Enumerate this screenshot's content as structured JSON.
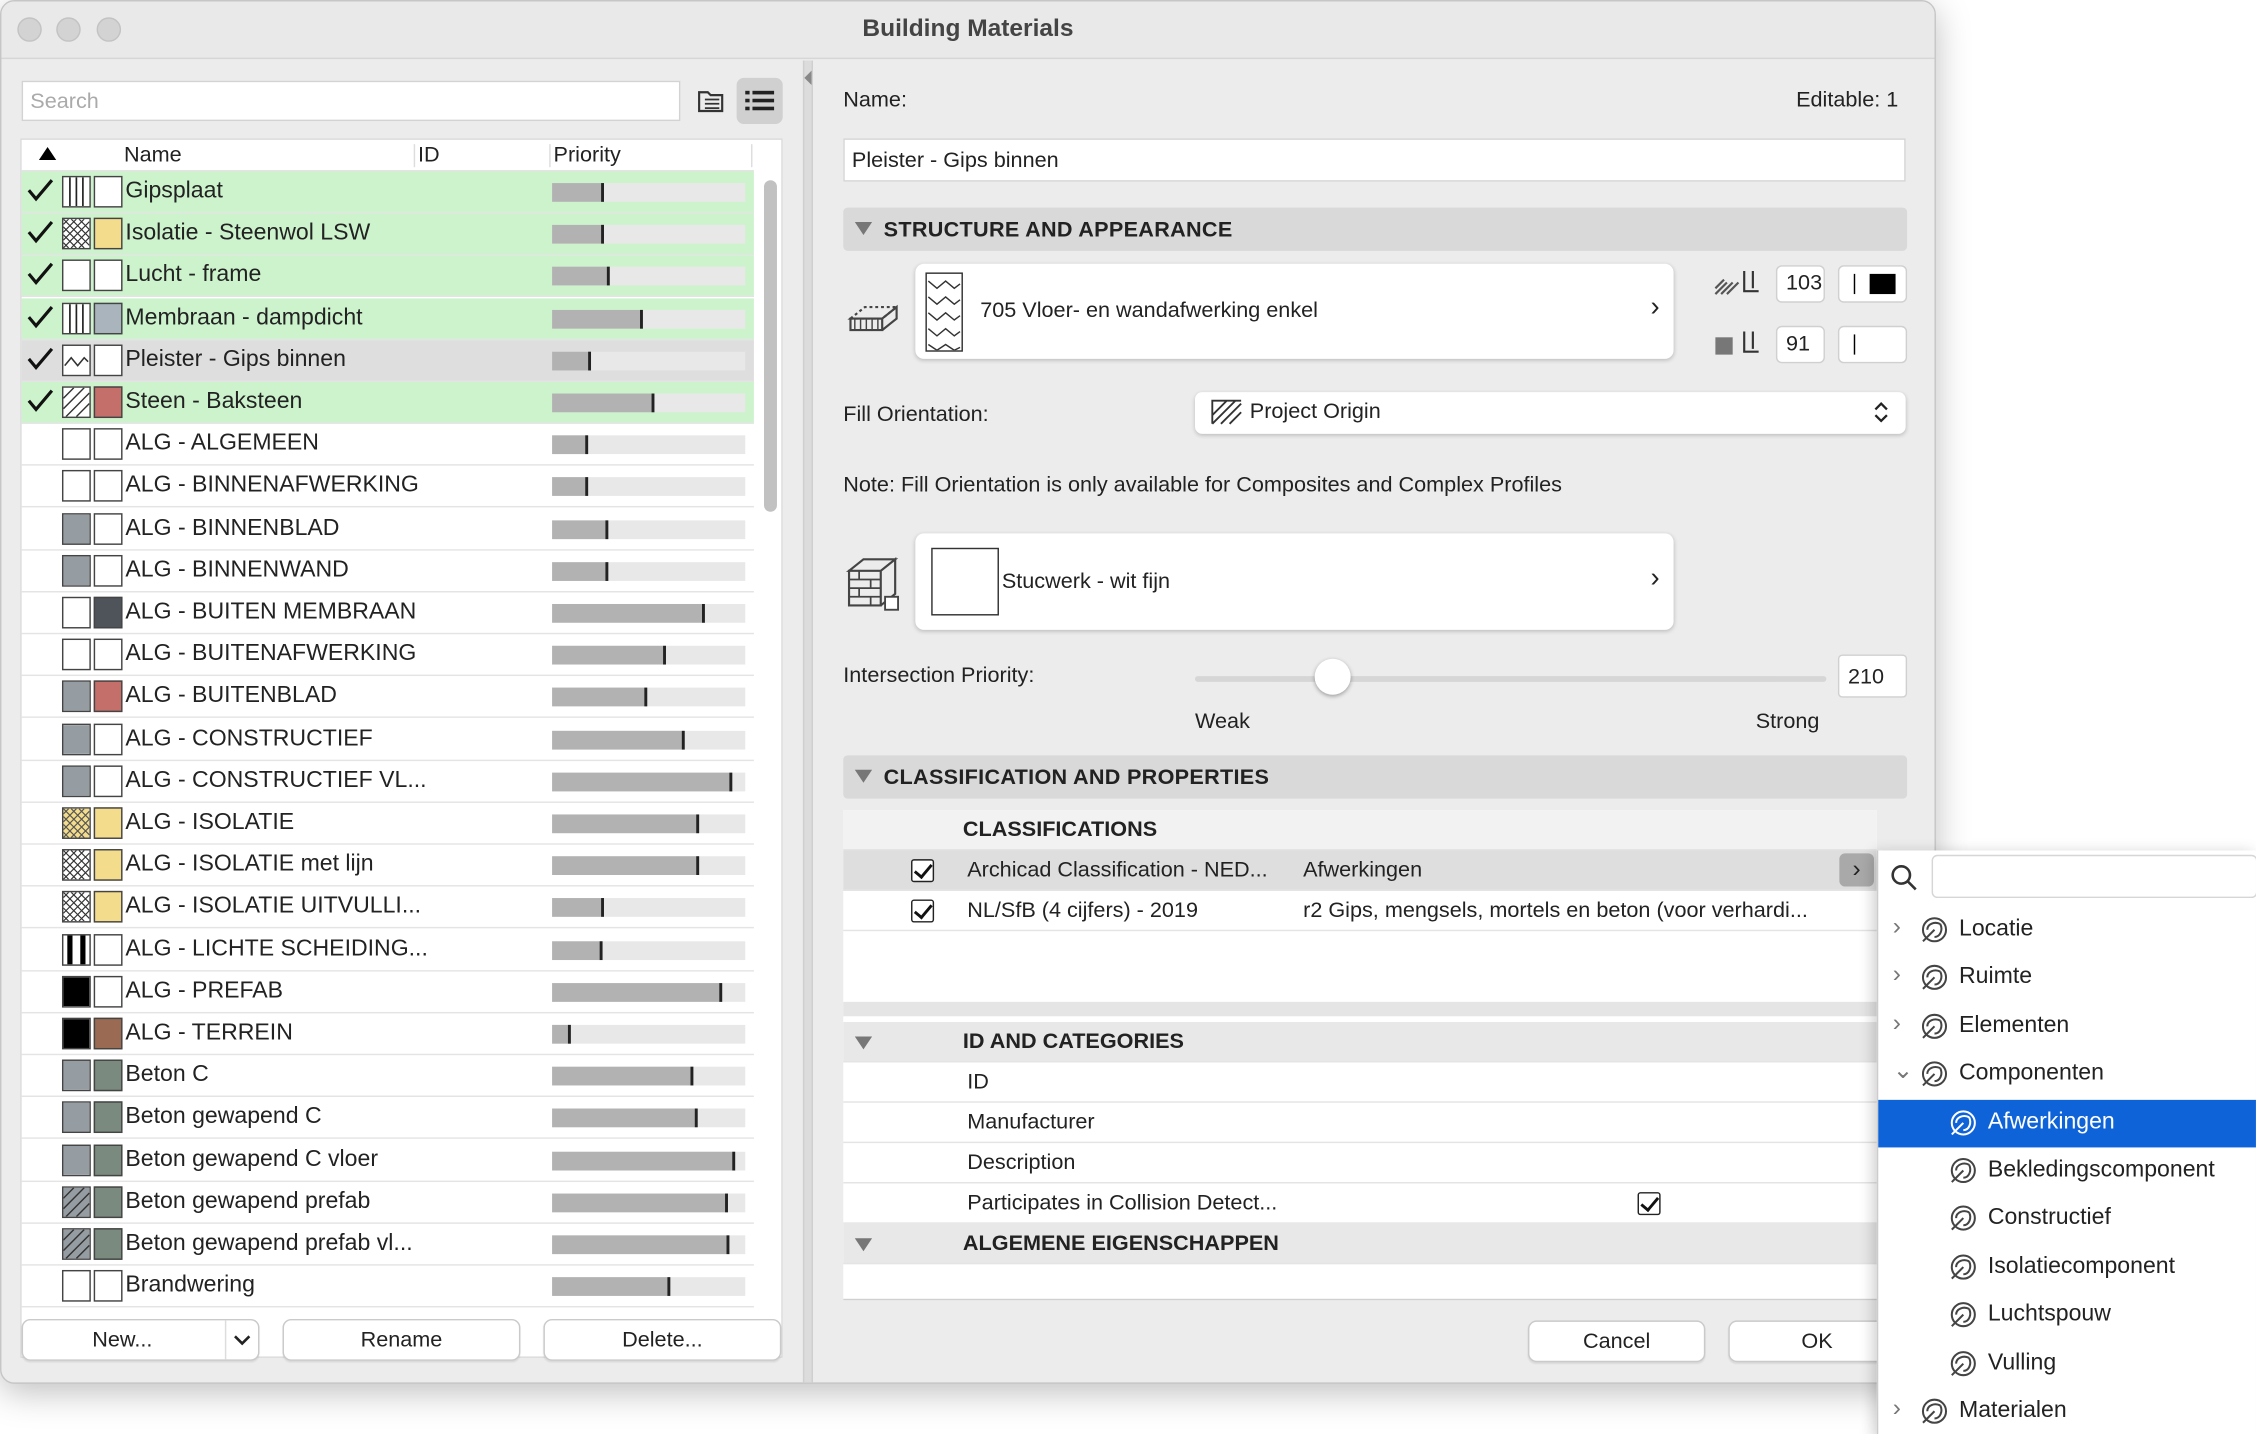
{
  "window": {
    "title": "Building Materials"
  },
  "search": {
    "placeholder": "Search"
  },
  "list": {
    "columns": {
      "name": "Name",
      "id": "ID",
      "priority": "Priority"
    },
    "rows": [
      {
        "name": "Gipsplaat",
        "checked": true,
        "state": "sel",
        "fill": "vlines",
        "color": "#ffffff",
        "priority": 0.27
      },
      {
        "name": "Isolatie - Steenwol LSW",
        "checked": true,
        "state": "sel",
        "fill": "cross",
        "color": "#f3dc8c",
        "priority": 0.27
      },
      {
        "name": "Lucht - frame",
        "checked": true,
        "state": "sel",
        "fill": "empty",
        "color": "#ffffff",
        "priority": 0.3
      },
      {
        "name": "Membraan - dampdicht",
        "checked": true,
        "state": "sel",
        "fill": "vlines",
        "color": "#aab4bc",
        "priority": 0.47
      },
      {
        "name": "Pleister - Gips binnen",
        "checked": true,
        "state": "cur",
        "fill": "zigzag",
        "color": "#ffffff",
        "priority": 0.2
      },
      {
        "name": "Steen - Baksteen",
        "checked": true,
        "state": "sel",
        "fill": "diag",
        "color": "#c46f6a",
        "priority": 0.53
      },
      {
        "name": "ALG - ALGEMEEN",
        "checked": false,
        "state": "",
        "fill": "empty",
        "color": "#ffffff",
        "priority": 0.19
      },
      {
        "name": "ALG - BINNENAFWERKING",
        "checked": false,
        "state": "",
        "fill": "empty",
        "color": "#ffffff",
        "priority": 0.19
      },
      {
        "name": "ALG - BINNENBLAD",
        "checked": false,
        "state": "",
        "fill": "gray",
        "color": "#ffffff",
        "priority": 0.29
      },
      {
        "name": "ALG - BINNENWAND",
        "checked": false,
        "state": "",
        "fill": "gray",
        "color": "#ffffff",
        "priority": 0.29
      },
      {
        "name": "ALG - BUITEN MEMBRAAN",
        "checked": false,
        "state": "",
        "fill": "empty",
        "color": "#4e5459",
        "priority": 0.79
      },
      {
        "name": "ALG - BUITENAFWERKING",
        "checked": false,
        "state": "",
        "fill": "empty",
        "color": "#ffffff",
        "priority": 0.59
      },
      {
        "name": "ALG - BUITENBLAD",
        "checked": false,
        "state": "",
        "fill": "gray",
        "color": "#c46f6a",
        "priority": 0.49
      },
      {
        "name": "ALG - CONSTRUCTIEF",
        "checked": false,
        "state": "",
        "fill": "gray",
        "color": "#ffffff",
        "priority": 0.69
      },
      {
        "name": "ALG - CONSTRUCTIEF VL...",
        "checked": false,
        "state": "",
        "fill": "gray",
        "color": "#ffffff",
        "priority": 0.93
      },
      {
        "name": "ALG - ISOLATIE",
        "checked": false,
        "state": "",
        "fill": "crossy",
        "color": "#f3dc8c",
        "priority": 0.76
      },
      {
        "name": "ALG - ISOLATIE met lijn",
        "checked": false,
        "state": "",
        "fill": "cross",
        "color": "#f3dc8c",
        "priority": 0.76
      },
      {
        "name": "ALG - ISOLATIE UITVULLI...",
        "checked": false,
        "state": "",
        "fill": "cross",
        "color": "#f3dc8c",
        "priority": 0.27
      },
      {
        "name": "ALG - LICHTE SCHEIDING...",
        "checked": false,
        "state": "",
        "fill": "bars",
        "color": "#ffffff",
        "priority": 0.26
      },
      {
        "name": "ALG - PREFAB",
        "checked": false,
        "state": "",
        "fill": "black",
        "color": "#ffffff",
        "priority": 0.88
      },
      {
        "name": "ALG - TERREIN",
        "checked": false,
        "state": "",
        "fill": "black",
        "color": "#9a6b52",
        "priority": 0.1
      },
      {
        "name": "Beton C",
        "checked": false,
        "state": "",
        "fill": "gray",
        "color": "#7a8a7e",
        "priority": 0.73
      },
      {
        "name": "Beton gewapend C",
        "checked": false,
        "state": "",
        "fill": "gray",
        "color": "#7a8a7e",
        "priority": 0.75
      },
      {
        "name": "Beton gewapend C vloer",
        "checked": false,
        "state": "",
        "fill": "gray",
        "color": "#7a8a7e",
        "priority": 0.95
      },
      {
        "name": "Beton gewapend prefab",
        "checked": false,
        "state": "",
        "fill": "graydiag",
        "color": "#7a8a7e",
        "priority": 0.91
      },
      {
        "name": "Beton gewapend prefab vl...",
        "checked": false,
        "state": "",
        "fill": "graydiag",
        "color": "#7a8a7e",
        "priority": 0.92
      },
      {
        "name": "Brandwering",
        "checked": false,
        "state": "",
        "fill": "empty",
        "color": "#ffffff",
        "priority": 0.61
      }
    ]
  },
  "buttons": {
    "new": "New...",
    "rename": "Rename",
    "delete": "Delete...",
    "cancel": "Cancel",
    "ok": "OK"
  },
  "detail": {
    "name_label": "Name:",
    "editable": "Editable: 1",
    "name_value": "Pleister - Gips binnen",
    "structure": {
      "header": "STRUCTURE AND APPEARANCE",
      "fill_name": "705 Vloer- en wandafwerking enkel",
      "pen1": "103",
      "pen2": "91",
      "orientation_label": "Fill Orientation:",
      "orientation_value": "Project Origin",
      "note": "Note: Fill Orientation is only available for Composites and Complex Profiles",
      "surface_name": "Stucwerk - wit fijn",
      "priority_label": "Intersection Priority:",
      "priority_value": "210",
      "weak": "Weak",
      "strong": "Strong"
    },
    "classification": {
      "header": "CLASSIFICATION AND PROPERTIES",
      "sub_header": "CLASSIFICATIONS",
      "rows": [
        {
          "system": "Archicad Classification - NED...",
          "value": "Afwerkingen"
        },
        {
          "system": "NL/SfB (4 cijfers) - 2019",
          "value": "r2 Gips, mengsels, mortels en beton (voor verhardi..."
        }
      ],
      "id_header": "ID AND CATEGORIES",
      "props": [
        "ID",
        "Manufacturer",
        "Description",
        "Participates in Collision Detect..."
      ],
      "general_header": "ALGEMENE EIGENSCHAPPEN"
    }
  },
  "popup": {
    "items": [
      {
        "label": "Locatie",
        "level": 0,
        "expanded": false,
        "highlight": false
      },
      {
        "label": "Ruimte",
        "level": 0,
        "expanded": false,
        "highlight": false
      },
      {
        "label": "Elementen",
        "level": 0,
        "expanded": false,
        "highlight": false
      },
      {
        "label": "Componenten",
        "level": 0,
        "expanded": true,
        "highlight": false
      },
      {
        "label": "Afwerkingen",
        "level": 1,
        "expanded": false,
        "highlight": true
      },
      {
        "label": "Bekledingscomponent",
        "level": 1,
        "expanded": false,
        "highlight": false
      },
      {
        "label": "Constructief",
        "level": 1,
        "expanded": false,
        "highlight": false
      },
      {
        "label": "Isolatiecomponent",
        "level": 1,
        "expanded": false,
        "highlight": false
      },
      {
        "label": "Luchtspouw",
        "level": 1,
        "expanded": false,
        "highlight": false
      },
      {
        "label": "Vulling",
        "level": 1,
        "expanded": false,
        "highlight": false
      },
      {
        "label": "Materialen",
        "level": 0,
        "expanded": false,
        "highlight": false
      }
    ]
  }
}
